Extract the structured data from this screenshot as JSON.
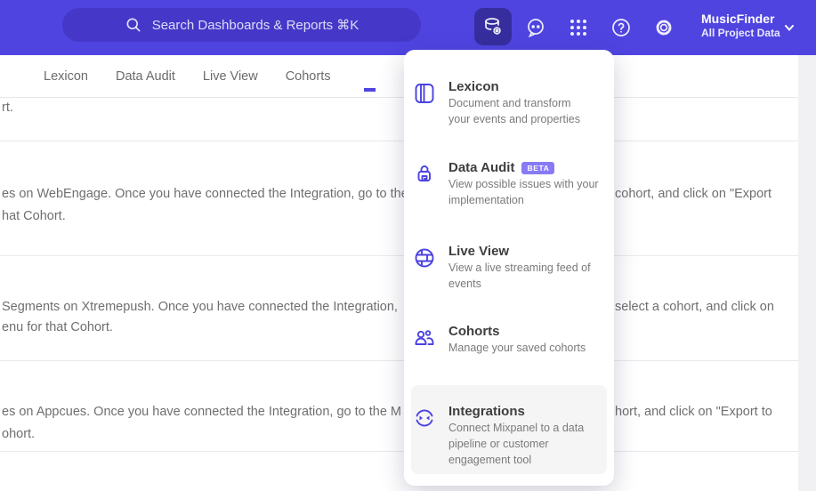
{
  "header": {
    "search": {
      "placeholder": "Search Dashboards & Reports ⌘K",
      "icon": "search-icon"
    },
    "icons": [
      "data-management-icon",
      "feedback-icon",
      "apps-grid-icon",
      "help-icon",
      "settings-icon"
    ],
    "project": {
      "name": "MusicFinder",
      "subtitle": "All Project Data"
    }
  },
  "tabs": [
    {
      "label": "Lexicon"
    },
    {
      "label": "Data Audit"
    },
    {
      "label": "Live View"
    },
    {
      "label": "Cohorts"
    }
  ],
  "menu": {
    "items": [
      {
        "title": "Lexicon",
        "icon": "lexicon-book-icon",
        "desc": "Document and transform\nyour events and properties"
      },
      {
        "title": "Data Audit",
        "badge": "BETA",
        "icon": "data-audit-lock-icon",
        "desc": "View possible issues with your\nimplementation"
      },
      {
        "title": "Live View",
        "icon": "live-view-globe-icon",
        "desc": "View a live streaming feed of\nevents"
      },
      {
        "title": "Cohorts",
        "icon": "cohorts-people-icon",
        "desc": "Manage your saved cohorts"
      },
      {
        "title": "Integrations",
        "icon": "integrations-sync-icon",
        "desc": "Connect Mixpanel to a data\npipeline or customer\nengagement tool",
        "highlighted": true
      }
    ]
  },
  "content": {
    "rows": [
      {
        "left1": "rt.",
        "right1": "",
        "left2": ""
      },
      {
        "left1": "es on WebEngage. Once you have connected the Integration, go to the",
        "right1": "cohort, and click on \"Export",
        "left2": "hat Cohort."
      },
      {
        "left1": "Segments on Xtremepush. Once you have connected the Integration, ",
        "right1": "select a cohort, and click on",
        "left2": "enu for that Cohort."
      },
      {
        "left1": "es on Appcues. Once you have connected the Integration, go to the M",
        "right1": "hort, and click on \"Export to",
        "left2": "ohort."
      }
    ]
  },
  "colors": {
    "header_bg": "#4F44E0",
    "search_bg": "#4538C8",
    "active_icon_bg": "#362E9E",
    "accent": "#4C43E0",
    "badge_bg": "#877AF3",
    "body_text": "#6F6F6F",
    "menu_highlight": "#F5F5F6"
  }
}
